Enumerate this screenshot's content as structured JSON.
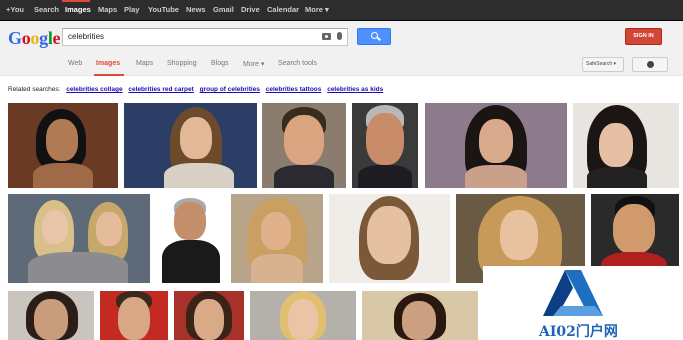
{
  "topbar": {
    "links": [
      "+You",
      "Search",
      "Images",
      "Maps",
      "Play",
      "YouTube",
      "News",
      "Gmail",
      "Drive",
      "Calendar",
      "More ▾"
    ],
    "active_index": 2
  },
  "header": {
    "logo": "Google",
    "query": "celebrities",
    "signin_label": "SIGN IN"
  },
  "tabs": {
    "items": [
      "Web",
      "Images",
      "Maps",
      "Shopping",
      "Blogs",
      "More ▾",
      "Search tools"
    ],
    "active_index": 1,
    "safesearch_label": "SafeSearch ▾"
  },
  "related": {
    "label": "Related searches:",
    "links": [
      "celebrities collage",
      "celebrities red carpet",
      "group of celebrities",
      "celebrities tattoos",
      "celebrities as kids"
    ]
  },
  "watermark": {
    "text": "AI02门户网"
  },
  "colors": {
    "accent_red": "#dd4b39",
    "search_blue": "#4d90fe",
    "link_blue": "#1a0dab"
  }
}
